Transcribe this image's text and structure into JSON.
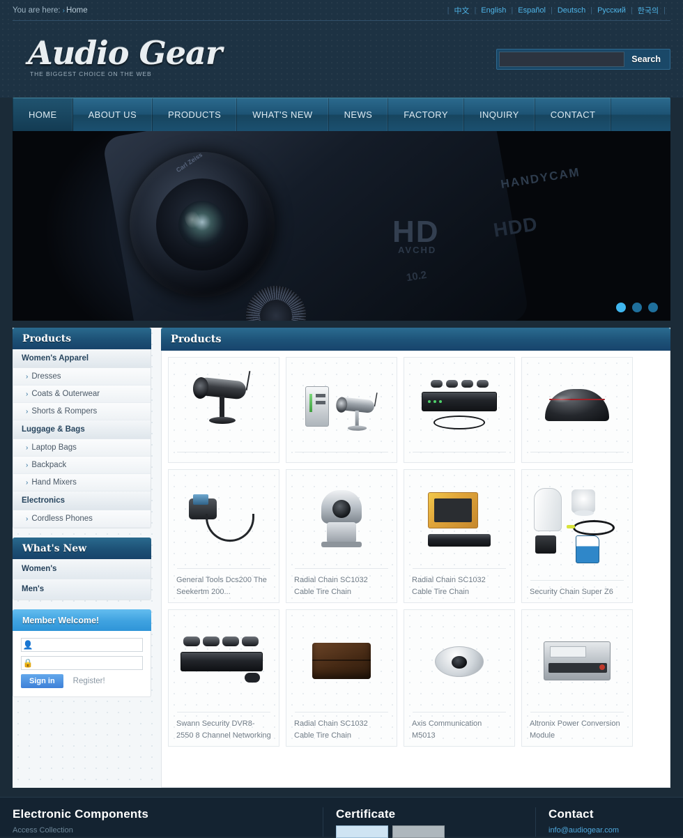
{
  "topbar": {
    "breadcrumb_prefix": "You are here:",
    "breadcrumb_arrow": "›",
    "breadcrumb_current": "Home",
    "languages": [
      {
        "label": "中文"
      },
      {
        "label": "English"
      },
      {
        "label": "Español"
      },
      {
        "label": "Deutsch"
      },
      {
        "label": "Русский"
      },
      {
        "label": "한국의"
      }
    ],
    "separator": "|"
  },
  "masthead": {
    "logo_text": "Audio Gear",
    "logo_tagline": "THE BIGGEST CHOICE ON THE WEB",
    "search_value": "",
    "search_placeholder": "",
    "search_button": "Search"
  },
  "nav": {
    "items": [
      {
        "label": "HOME",
        "active": true
      },
      {
        "label": "ABOUT US",
        "active": false
      },
      {
        "label": "PRODUCTS",
        "active": false
      },
      {
        "label": "WHAT'S NEW",
        "active": false
      },
      {
        "label": "NEWS",
        "active": false
      },
      {
        "label": "FACTORY",
        "active": false
      },
      {
        "label": "INQUIRY",
        "active": false
      },
      {
        "label": "CONTACT",
        "active": false
      }
    ]
  },
  "hero": {
    "badge_hd": "HD",
    "badge_avchd": "AVCHD",
    "brand_handycam": "HANDYCAM",
    "label_hdd": "HDD",
    "label_megapixels": "10.2",
    "label_lens": "Carl Zeiss",
    "slides_total": 3,
    "active_slide": 1
  },
  "sidebar": {
    "products_panel": {
      "title": "Products",
      "entries": [
        {
          "label": "Women's Apparel",
          "type": "group"
        },
        {
          "label": "Dresses",
          "type": "item"
        },
        {
          "label": "Coats & Outerwear",
          "type": "item"
        },
        {
          "label": "Shorts & Rompers",
          "type": "item"
        },
        {
          "label": "Luggage & Bags",
          "type": "group"
        },
        {
          "label": "Laptop Bags",
          "type": "item"
        },
        {
          "label": "Backpack",
          "type": "item"
        },
        {
          "label": "Hand Mixers",
          "type": "item"
        },
        {
          "label": "Electronics",
          "type": "group"
        },
        {
          "label": "Cordless Phones",
          "type": "item"
        }
      ],
      "item_arrow": "›"
    },
    "whatsnew_panel": {
      "title": "What's New",
      "entries": [
        {
          "label": "Women's"
        },
        {
          "label": "Men's"
        }
      ]
    },
    "member_panel": {
      "title": "Member Welcome!",
      "username_value": "",
      "username_placeholder": "",
      "password_value": "",
      "password_placeholder": "",
      "username_icon": "user-icon",
      "password_icon": "lock-icon",
      "signin_label": "Sign in",
      "register_label": "Register!"
    }
  },
  "content": {
    "title": "Products",
    "products": [
      {
        "caption": "",
        "art": "bullet-cam-black",
        "row": 1
      },
      {
        "caption": "",
        "art": "cam-kit-silver",
        "row": 1
      },
      {
        "caption": "",
        "art": "dvr-kit",
        "row": 1
      },
      {
        "caption": "",
        "art": "dome-cam-black",
        "row": 1
      },
      {
        "caption": "General Tools Dcs200 The Seekertm 200...",
        "art": "inspection-scope",
        "row": 2
      },
      {
        "caption": "Radial Chain SC1032 Cable Tire Chain",
        "art": "ptz-camera",
        "row": 2
      },
      {
        "caption": "Radial Chain SC1032 Cable Tire Chain",
        "art": "dvr-package",
        "row": 2
      },
      {
        "caption": "Security Chain Super Z6",
        "art": "security-kit",
        "row": 2
      },
      {
        "caption": "Swann Security DVR8-2550 8 Channel Networking",
        "art": "dvr-stack",
        "row": 3
      },
      {
        "caption": "Radial Chain SC1032 Cable Tire Chain",
        "art": "leather-wallet",
        "row": 3
      },
      {
        "caption": "Axis Communication M5013",
        "art": "dome-camera-small",
        "row": 3
      },
      {
        "caption": "Altronix Power Conversion Module",
        "art": "power-module",
        "row": 3
      }
    ]
  },
  "footer": {
    "columns": [
      {
        "title": "Electronic Components",
        "sub": "Access Collection"
      },
      {
        "title": "Certificate",
        "sub": ""
      },
      {
        "title": "Contact",
        "sub": ""
      }
    ],
    "contact_link": "info@audiogear.com"
  },
  "colors": {
    "header_bg": "#1d3243",
    "nav_blue": "#1d5374",
    "panel_header": "#1d5176",
    "accent_light_blue": "#3fa2e0",
    "link_blue": "#4fb5e8",
    "footer_bg": "#142331"
  }
}
